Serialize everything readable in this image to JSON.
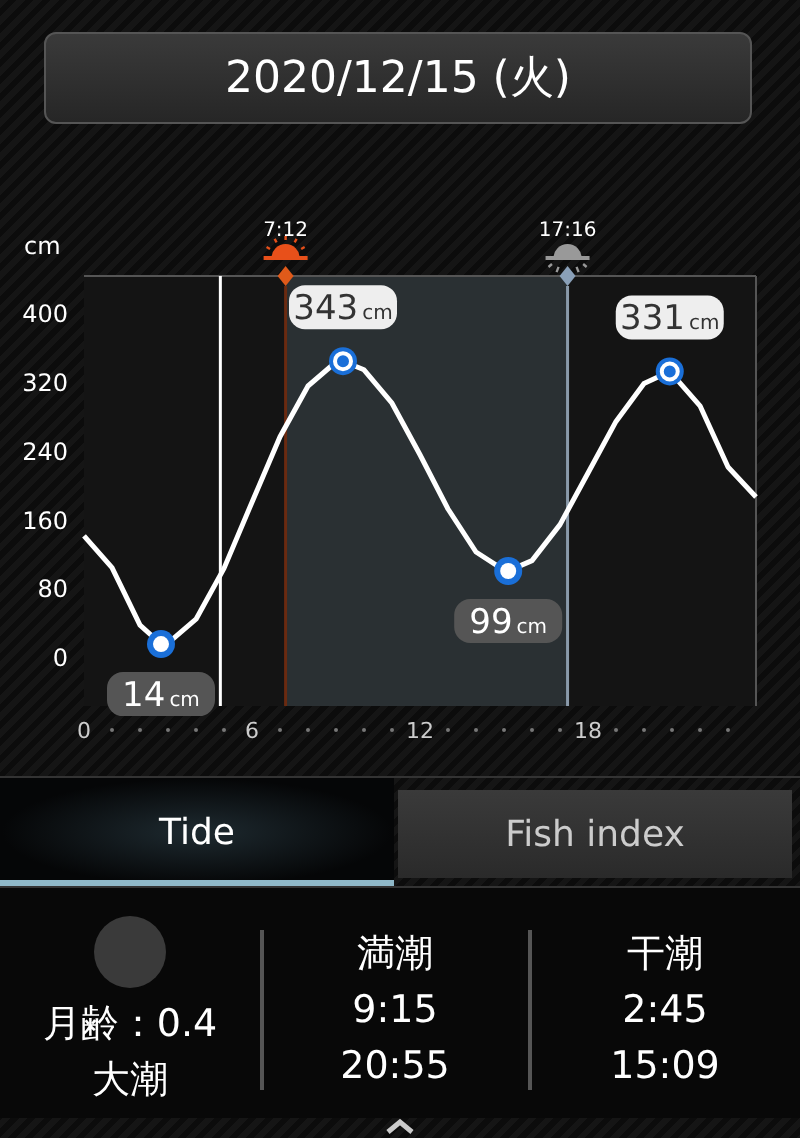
{
  "date_button": {
    "label": "2020/12/15 (火)"
  },
  "tide_chart": {
    "unit": "cm",
    "sun_icons": [
      {
        "kind": "sunrise"
      },
      {
        "kind": "sunset"
      }
    ],
    "extremes": [
      {
        "kind": "low",
        "value": "14",
        "unit": "cm"
      },
      {
        "kind": "high",
        "value": "343",
        "unit": "cm"
      },
      {
        "kind": "low",
        "value": "99",
        "unit": "cm"
      },
      {
        "kind": "high",
        "value": "331",
        "unit": "cm"
      }
    ],
    "chart_data": {
      "type": "line",
      "x": [
        0,
        1,
        2,
        2.75,
        3,
        4,
        5,
        6,
        7,
        8,
        9,
        9.25,
        10,
        11,
        12,
        13,
        14,
        15,
        15.15,
        16,
        17,
        18,
        19,
        20,
        20.92,
        22,
        23,
        24
      ],
      "series": [
        {
          "color": "#ffffff",
          "values": [
            140,
            103,
            36,
            14,
            15,
            43,
            102,
            179,
            255,
            314,
            342,
            343,
            333,
            294,
            234,
            171,
            121,
            100,
            99,
            111,
            153,
            213,
            273,
            317,
            331,
            291,
            220,
            185
          ]
        }
      ],
      "ref_lines": [
        {
          "axis": "x",
          "value": 4.87,
          "color": "#ffffff"
        },
        {
          "axis": "x",
          "value": 7.2,
          "color": "#6a2a10",
          "label": "7:12"
        },
        {
          "axis": "x",
          "value": 17.27,
          "color": "#8a9aaa",
          "label": "17:16"
        }
      ],
      "bands": [
        {
          "axis": "x",
          "from": 7.2,
          "to": 17.27,
          "color": "#2a3033"
        }
      ],
      "xlim": [
        0,
        24
      ],
      "ylim": [
        -58,
        442
      ],
      "xticks": [
        0,
        6,
        12,
        18
      ],
      "yticks": [
        0,
        80,
        160,
        240,
        320,
        400
      ]
    }
  },
  "tabs": [
    {
      "label": "Tide",
      "selected": true
    },
    {
      "label": "Fish index",
      "selected": false
    }
  ],
  "moon": {
    "age": "月齢：0.4",
    "tide_name": "大潮"
  },
  "columns": [
    {
      "title": "満潮",
      "times": [
        "9:15",
        "20:55"
      ]
    },
    {
      "title": "干潮",
      "times": [
        "2:45",
        "15:09"
      ]
    }
  ]
}
